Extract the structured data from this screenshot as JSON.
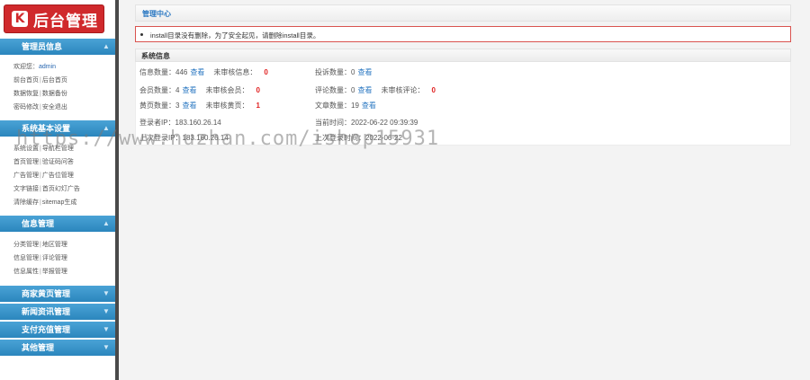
{
  "brand": {
    "logo_letter": "K",
    "title": "后台管理"
  },
  "sidebar": {
    "sections": [
      {
        "title": "管理员信息",
        "links": [
          [
            "欢迎您：",
            "admin"
          ],
          [
            "前台首页",
            "后台首页"
          ],
          [
            "数据恢复",
            "数据备份"
          ],
          [
            "密码修改",
            "安全退出"
          ]
        ]
      },
      {
        "title": "系统基本设置",
        "links": [
          [
            "系统设置",
            "导航栏管理"
          ],
          [
            "首页管理",
            "验证码问答"
          ],
          [
            "广告管理",
            "广告位管理"
          ],
          [
            "文字链接",
            "首页幻灯广告"
          ],
          [
            "清除缓存",
            "sitemap生成"
          ]
        ]
      },
      {
        "title": "信息管理",
        "links": [
          [
            "分类管理",
            "地区管理"
          ],
          [
            "信息管理",
            "评论管理"
          ],
          [
            "信息属性",
            "举报管理"
          ]
        ]
      },
      {
        "title": "商家黄页管理",
        "links": []
      },
      {
        "title": "新闻资讯管理",
        "links": []
      },
      {
        "title": "支付充值管理",
        "links": []
      },
      {
        "title": "其他管理",
        "links": []
      }
    ]
  },
  "main": {
    "center_title": "管理中心",
    "warning": "install目录没有删除，为了安全起见，请删除install目录。",
    "sys_title": "系统信息",
    "stats": {
      "info_count": {
        "label": "信息数量：",
        "value": "446",
        "link": "查看",
        "unreviewed_label": "未审核信息：",
        "unreviewed": "0"
      },
      "report_count": {
        "label": "投诉数量：",
        "value": "0",
        "link": "查看"
      },
      "member_count": {
        "label": "会员数量：",
        "value": "4",
        "link": "查看",
        "unreviewed_label": "未审核会员：",
        "unreviewed": "0"
      },
      "comment_count": {
        "label": "评论数量：",
        "value": "0",
        "link": "查看",
        "unreviewed_label": "未审核评论：",
        "unreviewed": "0"
      },
      "yellow_count": {
        "label": "黄页数量：",
        "value": "3",
        "link": "查看",
        "unreviewed_label": "未审核黄页：",
        "unreviewed": "1"
      },
      "article_count": {
        "label": "文章数量：",
        "value": "19",
        "link": "查看"
      },
      "login_ip": "登录者IP：183.160.26.14",
      "current_time": "当前时间：2022-06-22 09:39:39",
      "last_ip": "上次登录IP：183.160.26.14",
      "last_time": "上次登录时间：2022-06-22"
    }
  },
  "watermark": "https://www.huzhan.com/ishop15931"
}
